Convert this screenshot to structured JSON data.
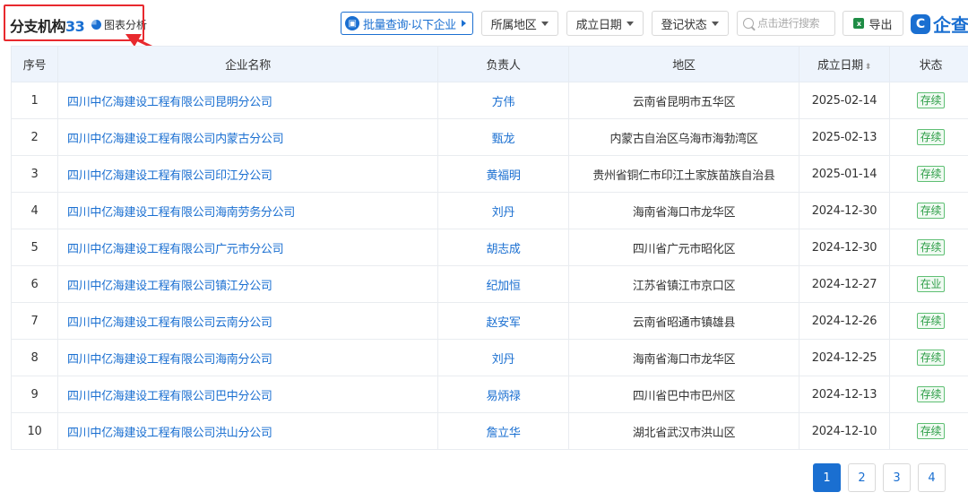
{
  "header": {
    "title": "分支机构",
    "count": "33",
    "chart_link": "图表分析"
  },
  "toolbar": {
    "batch_query": "批量查询·以下企业",
    "region": "所属地区",
    "founded_date": "成立日期",
    "reg_status": "登记状态",
    "search_placeholder": "点击进行搜索",
    "export": "导出",
    "brand": "企查"
  },
  "table": {
    "columns": [
      "序号",
      "企业名称",
      "负责人",
      "地区",
      "成立日期",
      "状态"
    ],
    "rows": [
      {
        "no": "1",
        "name": "四川中亿海建设工程有限公司昆明分公司",
        "person": "方伟",
        "region": "云南省昆明市五华区",
        "date": "2025-02-14",
        "status": "存续"
      },
      {
        "no": "2",
        "name": "四川中亿海建设工程有限公司内蒙古分公司",
        "person": "甄龙",
        "region": "内蒙古自治区乌海市海勃湾区",
        "date": "2025-02-13",
        "status": "存续"
      },
      {
        "no": "3",
        "name": "四川中亿海建设工程有限公司印江分公司",
        "person": "黄福明",
        "region": "贵州省铜仁市印江土家族苗族自治县",
        "date": "2025-01-14",
        "status": "存续"
      },
      {
        "no": "4",
        "name": "四川中亿海建设工程有限公司海南劳务分公司",
        "person": "刘丹",
        "region": "海南省海口市龙华区",
        "date": "2024-12-30",
        "status": "存续"
      },
      {
        "no": "5",
        "name": "四川中亿海建设工程有限公司广元市分公司",
        "person": "胡志成",
        "region": "四川省广元市昭化区",
        "date": "2024-12-30",
        "status": "存续"
      },
      {
        "no": "6",
        "name": "四川中亿海建设工程有限公司镇江分公司",
        "person": "纪加恒",
        "region": "江苏省镇江市京口区",
        "date": "2024-12-27",
        "status": "在业"
      },
      {
        "no": "7",
        "name": "四川中亿海建设工程有限公司云南分公司",
        "person": "赵安军",
        "region": "云南省昭通市镇雄县",
        "date": "2024-12-26",
        "status": "存续"
      },
      {
        "no": "8",
        "name": "四川中亿海建设工程有限公司海南分公司",
        "person": "刘丹",
        "region": "海南省海口市龙华区",
        "date": "2024-12-25",
        "status": "存续"
      },
      {
        "no": "9",
        "name": "四川中亿海建设工程有限公司巴中分公司",
        "person": "易炳禄",
        "region": "四川省巴中市巴州区",
        "date": "2024-12-13",
        "status": "存续"
      },
      {
        "no": "10",
        "name": "四川中亿海建设工程有限公司洪山分公司",
        "person": "詹立华",
        "region": "湖北省武汉市洪山区",
        "date": "2024-12-10",
        "status": "存续"
      }
    ]
  },
  "pagination": {
    "pages": [
      "1",
      "2",
      "3",
      "4"
    ],
    "current": "1"
  },
  "colors": {
    "accent": "#1a6fd1",
    "annotation": "#e8292e",
    "status_green": "#2e9e48"
  }
}
